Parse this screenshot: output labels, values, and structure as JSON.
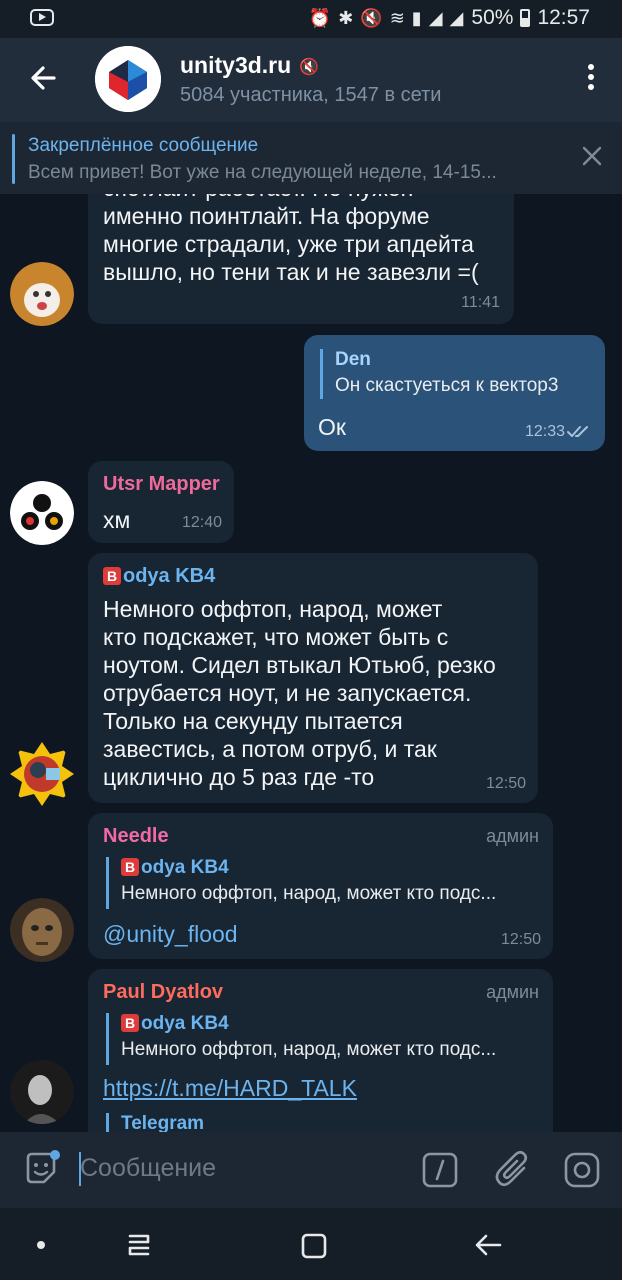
{
  "status": {
    "battery": "50%",
    "time": "12:57"
  },
  "chat": {
    "title": "unity3d.ru",
    "subtitle": "5084 участника, 1547 в сети"
  },
  "pinned": {
    "title": "Закреплённое сообщение",
    "text": "Всем привет! Вот уже на следующей неделе, 14-15..."
  },
  "messages": {
    "m1": {
      "lines": [
        "спотлайт работает. Но нужен",
        "именно поинтлайт. На форуме",
        "многие страдали, уже три апдейта",
        "вышло, но тени так и не завезли =("
      ],
      "time": "11:41"
    },
    "m2": {
      "reply_name": "Den",
      "reply_text": "Он скастуеться к вектор3",
      "text": "Ок",
      "time": "12:33"
    },
    "m3": {
      "sender": "Utsr Mapper",
      "text": "хм",
      "time": "12:40"
    },
    "m4": {
      "sender_badge": "B",
      "sender": "odya KB4",
      "lines": [
        "Немного оффтоп, народ, может",
        "кто подскажет, что может быть с",
        "ноутом. Сидел втыкал Ютьюб, резко",
        "отрубается ноут, и не запускается.",
        "Только на секунду пытается",
        "завестись, а потом отруб, и так",
        "циклично до 5 раз где -то"
      ],
      "time": "12:50"
    },
    "m5": {
      "sender": "Needle",
      "role": "админ",
      "reply_badge": "B",
      "reply_name": "odya KB4",
      "reply_text": "Немного оффтоп, народ, может кто подс...",
      "text": "@unity_flood",
      "time": "12:50"
    },
    "m6": {
      "sender": "Paul Dyatlov",
      "role": "админ",
      "reply_badge": "B",
      "reply_name": "odya KB4",
      "reply_text": "Немного оффтоп, народ, может кто подс...",
      "text": "https://t.me/HARD_TALK",
      "preview_site": "Telegram"
    }
  },
  "input": {
    "placeholder": "Сообщение"
  },
  "colors": {
    "accent": "#5fa7e3",
    "bubble_in": "#182533",
    "bubble_out": "#2b5278",
    "needle": "#f06ba5",
    "paul": "#ff6b5d",
    "utsr": "#ee6a9a"
  }
}
